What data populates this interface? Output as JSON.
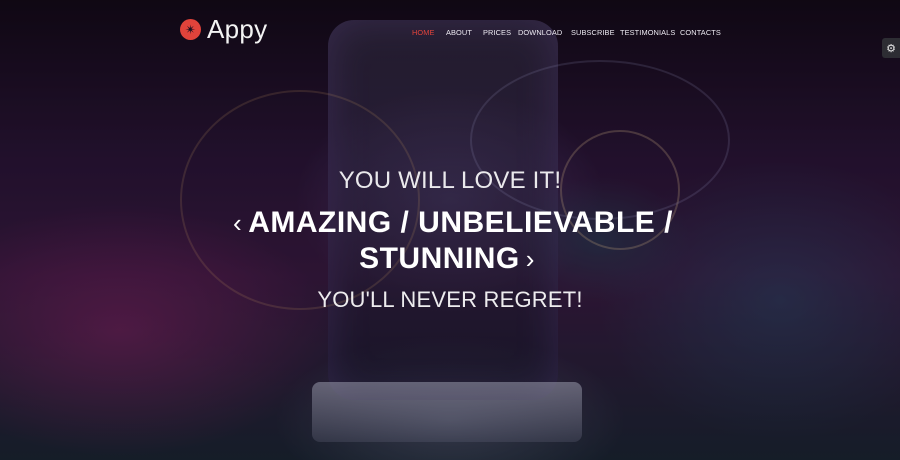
{
  "brand": {
    "name": "Appy",
    "logo_icon": "star-badge-icon",
    "accent_color": "#e0433b"
  },
  "nav": {
    "items": [
      {
        "label": "HOME",
        "active": true
      },
      {
        "label": "ABOUT",
        "active": false
      },
      {
        "label": "PRICES",
        "active": false
      },
      {
        "label": "DOWNLOAD",
        "active": false
      },
      {
        "label": "SUBSCRIBE",
        "active": false
      },
      {
        "label": "TESTIMONIALS",
        "active": false
      },
      {
        "label": "CONTACTS",
        "active": false
      }
    ]
  },
  "settings": {
    "icon": "gear-icon"
  },
  "hero": {
    "tagline_top": "YOU WILL LOVE IT!",
    "headline_left_icon": "chevron-left-icon",
    "headline_line1": "AMAZING / UNBELIEVABLE /",
    "headline_line2": "STUNNING",
    "headline_right_icon": "chevron-right-icon",
    "tagline_bottom": "YOU'LL NEVER REGRET!"
  }
}
